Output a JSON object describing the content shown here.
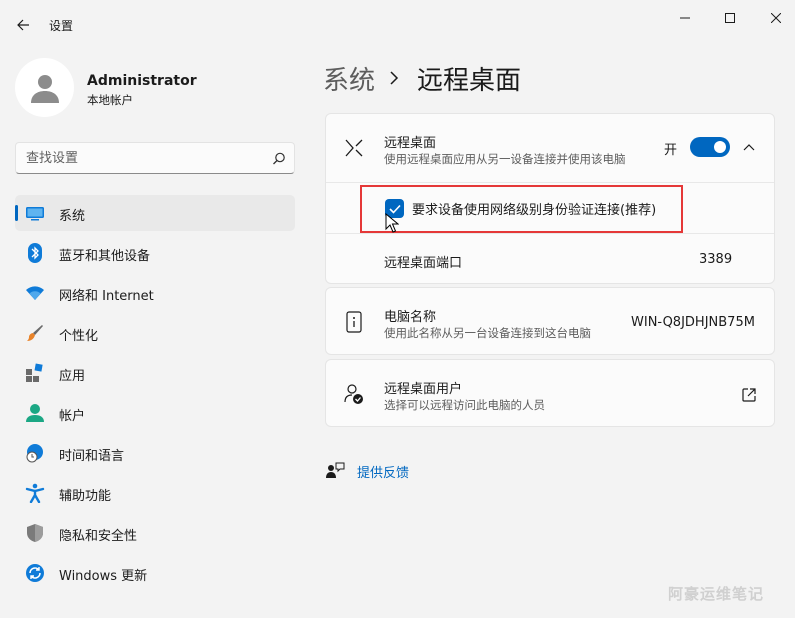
{
  "window": {
    "title": "设置",
    "back_icon": "arrow-left-icon",
    "controls": [
      "minimize-icon",
      "maximize-icon",
      "close-icon"
    ]
  },
  "profile": {
    "name": "Administrator",
    "account_type": "本地帐户"
  },
  "search": {
    "placeholder": "查找设置",
    "value": ""
  },
  "sidebar": {
    "items": [
      {
        "label": "系统",
        "icon": "system-display-icon",
        "active": true
      },
      {
        "label": "蓝牙和其他设备",
        "icon": "bluetooth-icon",
        "active": false
      },
      {
        "label": "网络和 Internet",
        "icon": "wifi-icon",
        "active": false
      },
      {
        "label": "个性化",
        "icon": "brush-icon",
        "active": false
      },
      {
        "label": "应用",
        "icon": "apps-icon",
        "active": false
      },
      {
        "label": "帐户",
        "icon": "account-icon",
        "active": false
      },
      {
        "label": "时间和语言",
        "icon": "globe-clock-icon",
        "active": false
      },
      {
        "label": "辅助功能",
        "icon": "accessibility-icon",
        "active": false
      },
      {
        "label": "隐私和安全性",
        "icon": "shield-icon",
        "active": false
      },
      {
        "label": "Windows 更新",
        "icon": "update-icon",
        "active": false
      }
    ]
  },
  "breadcrumb": {
    "parent": "系统",
    "current": "远程桌面"
  },
  "remote_desktop": {
    "title": "远程桌面",
    "subtitle": "使用远程桌面应用从另一设备连接并使用该电脑",
    "toggle_label": "开",
    "toggle_on": true,
    "nla_label": "要求设备使用网络级别身份验证连接(推荐)",
    "nla_checked": true,
    "port_label": "远程桌面端口",
    "port_value": "3389"
  },
  "pc_name": {
    "title": "电脑名称",
    "subtitle": "使用此名称从另一台设备连接到这台电脑",
    "value": "WIN-Q8JDHJNB75M"
  },
  "remote_users": {
    "title": "远程桌面用户",
    "subtitle": "选择可以远程访问此电脑的人员"
  },
  "feedback": {
    "label": "提供反馈"
  },
  "watermark": "阿豪运维笔记",
  "colors": {
    "accent": "#0067c0",
    "highlight": "#e53838",
    "background": "#f3f3f3",
    "card": "#fbfbfb"
  }
}
